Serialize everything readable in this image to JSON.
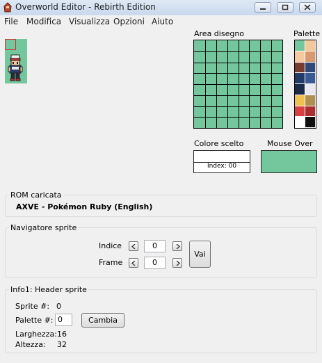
{
  "window": {
    "title": "Overworld Editor - Rebirth Edition"
  },
  "menu": [
    "File",
    "Modifica",
    "Visualizza",
    "Opzioni",
    "Aiuto"
  ],
  "area_disegno": {
    "label": "Area disegno",
    "fill_color": "#74c69d",
    "cols": 8,
    "rows": 8
  },
  "palette": {
    "label": "Palette",
    "colors": [
      "#74c69d",
      "#f4c79c",
      "#f6c8a0",
      "#d89a70",
      "#7a3a2e",
      "#2f4a78",
      "#223a66",
      "#3a5a96",
      "#1a2a48",
      "#e8e8f0",
      "#f0c050",
      "#b09050",
      "#d64040",
      "#a83030",
      "#ffffff",
      "#101010"
    ]
  },
  "colore_scelto": {
    "label": "Colore scelto",
    "index_text": "Index: 00",
    "color": "#ffffff"
  },
  "mouse_over": {
    "label": "Mouse Over",
    "color": "#74c69d"
  },
  "rom": {
    "group_title": "ROM caricata",
    "name": "AXVE - Pokémon Ruby (English)"
  },
  "navigatore": {
    "group_title": "Navigatore sprite",
    "indice_label": "Indice",
    "indice_value": "0",
    "frame_label": "Frame",
    "frame_value": "0",
    "vai_label": "Vai"
  },
  "info": {
    "group_title": "Info1: Header sprite",
    "sprite_label": "Sprite #:",
    "sprite_value": "0",
    "palette_label": "Palette #:",
    "palette_value": "0",
    "cambia_label": "Cambia",
    "larghezza_label": "Larghezza:",
    "larghezza_value": "16",
    "altezza_label": "Altezza:",
    "altezza_value": "32"
  }
}
